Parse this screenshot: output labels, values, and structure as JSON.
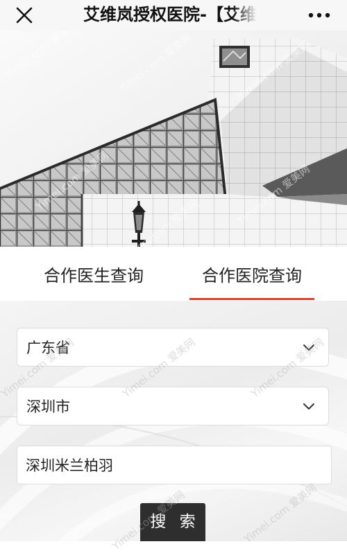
{
  "header": {
    "title": "艾维岚授权医院-【艾维岚",
    "close_icon": "close-icon",
    "more_icon": "more-dots-icon"
  },
  "hero": {
    "image": "architecture-glass-building-photo"
  },
  "tabs": [
    {
      "label": "合作医生查询",
      "active": false
    },
    {
      "label": "合作医院查询",
      "active": true
    }
  ],
  "form": {
    "province": {
      "value": "广东省",
      "icon": "chevron-down-icon"
    },
    "city": {
      "value": "深圳市",
      "icon": "chevron-down-icon"
    },
    "keyword": {
      "value": "深圳米兰柏羽"
    },
    "search_label": "搜 索"
  },
  "watermark": {
    "text": "Yimei.com 爱美网"
  },
  "colors": {
    "active_tab_underline": "#d9412d",
    "search_button_bg": "#2e2e2e",
    "topbar_bg": "#f7f7f7"
  }
}
